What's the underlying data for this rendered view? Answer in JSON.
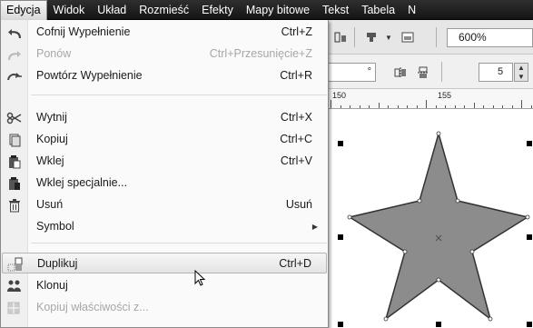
{
  "menubar": {
    "items": [
      "Edycja",
      "Widok",
      "Układ",
      "Rozmieść",
      "Efekty",
      "Mapy bitowe",
      "Tekst",
      "Tabela",
      "N"
    ]
  },
  "toolbar": {
    "zoom_value": "600%",
    "field_value": "°",
    "spin_value": "5"
  },
  "ruler": {
    "labels": [
      "150",
      "155"
    ]
  },
  "edit_menu": {
    "items": [
      {
        "label": "Cofnij Wypełnienie",
        "shortcut": "Ctrl+Z",
        "icon": "undo-icon",
        "disabled": false
      },
      {
        "label": "Ponów",
        "shortcut": "Ctrl+Przesunięcie+Z",
        "icon": "redo-icon",
        "disabled": true
      },
      {
        "label": "Powtórz Wypełnienie",
        "shortcut": "Ctrl+R",
        "icon": "repeat-icon",
        "disabled": false
      },
      {
        "label": "Wytnij",
        "shortcut": "Ctrl+X",
        "icon": "scissors-icon",
        "disabled": false
      },
      {
        "label": "Kopiuj",
        "shortcut": "Ctrl+C",
        "icon": "copy-icon",
        "disabled": false
      },
      {
        "label": "Wklej",
        "shortcut": "Ctrl+V",
        "icon": "paste-icon",
        "disabled": false
      },
      {
        "label": "Wklej specjalnie...",
        "shortcut": "",
        "icon": "paste-special-icon",
        "disabled": false
      },
      {
        "label": "Usuń",
        "shortcut": "Usuń",
        "icon": "trash-icon",
        "disabled": false
      },
      {
        "label": "Symbol",
        "shortcut": "",
        "icon": "",
        "disabled": false
      },
      {
        "label": "Duplikuj",
        "shortcut": "Ctrl+D",
        "icon": "duplicate-icon",
        "disabled": false
      },
      {
        "label": "Klonuj",
        "shortcut": "",
        "icon": "clone-icon",
        "disabled": false
      },
      {
        "label": "Kopiuj właściwości z...",
        "shortcut": "",
        "icon": "copy-properties-icon",
        "disabled": true
      }
    ]
  },
  "colors": {
    "menubar_bg": "#1e1e1e",
    "star_fill": "#8c8c8c",
    "menu_bg": "#fafafa"
  }
}
